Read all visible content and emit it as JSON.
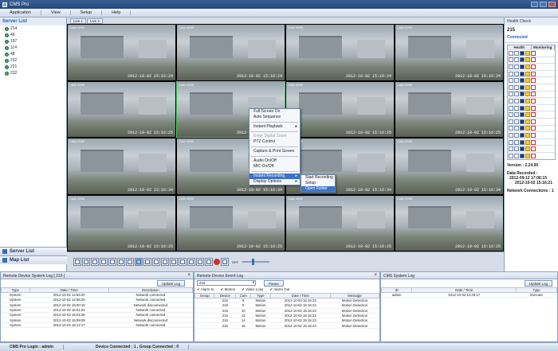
{
  "window": {
    "title": "CMS Pro"
  },
  "menu": [
    "Application",
    "View",
    "Setup",
    "Help"
  ],
  "server_list": {
    "title": "Server List",
    "items": [
      "214",
      "46",
      "197",
      "114",
      "48",
      "232",
      "221",
      "232"
    ]
  },
  "left_buttons": {
    "server": "Server List",
    "map": "Map List"
  },
  "tabs": [
    "Live 1",
    "Live 2"
  ],
  "cameras": [
    {
      "name": "CAM 9999",
      "ts": "2012-10-02 15:16:24"
    },
    {
      "name": "CAM 9999",
      "ts": "2012-10-02 15:16:24"
    },
    {
      "name": "CAM 9999",
      "ts": "2012-10-02 15:16:24"
    },
    {
      "name": "CAM 9999",
      "ts": "2012-10-02 15:16:24"
    },
    {
      "name": "CAM 9999",
      "ts": "2012-10-02 15:16:25"
    },
    {
      "name": "CAM 9999",
      "ts": "2012-10-02 15:16:25"
    },
    {
      "name": "CAM 9999",
      "ts": "2012-10-02 15:16:25"
    },
    {
      "name": "CAM 9999",
      "ts": "2012-10-02 15:16:25"
    },
    {
      "name": "CAM 9999",
      "ts": "2012-10-02 15:16:34"
    },
    {
      "name": "CAM 9999",
      "ts": "2012-10-02 15:16:34"
    },
    {
      "name": "CAM 9999",
      "ts": "2012-10-02 15:16:34"
    },
    {
      "name": "CAM 9999",
      "ts": "2012-10-02 15:16:34"
    },
    {
      "name": "CAM 9999",
      "ts": "2012-10-02 15:16:25"
    },
    {
      "name": "CAM 9999",
      "ts": "2012-10-02 15:16:25"
    },
    {
      "name": "CAM 9999",
      "ts": "2012-10-02 15:16:25"
    },
    {
      "name": "CAM 9999",
      "ts": "2012-10-02 15:16:25"
    }
  ],
  "context_menu": {
    "items": [
      "Full Screen On",
      "Auto Sequence",
      "Instant Playback",
      "Enter Digital Zoom",
      "PTZ Control",
      "Capture & Print Screen",
      "Audio On/Off",
      "MIC On/Off",
      "Instant Recording",
      "Display Options"
    ]
  },
  "submenu": {
    "items": [
      "Start Recording",
      "Setup",
      "Open Folder"
    ]
  },
  "audio_state": "OFF",
  "health": {
    "title": "Health Check",
    "server": "215",
    "connected": "Connected",
    "col1": "Health",
    "col2": "Monitoring",
    "version_label": "Version :",
    "version": "2.24.00",
    "data_label": "Data Recorded :",
    "data_from": "2012-09-12 17:06:15",
    "data_to": "2012-10-02 15:16:21",
    "net_label": "Network Connections :",
    "net": "1"
  },
  "system_log": {
    "title": "Remote Device System Log [ 215 ]",
    "update": "Update Log",
    "headers": [
      "Type",
      "Date / Time",
      "Description"
    ],
    "rows": [
      [
        "System",
        "2012-10-02 14:56:20",
        "Network connected"
      ],
      [
        "System",
        "2012-10-02 14:56:20",
        "Network connected"
      ],
      [
        "System",
        "2012-10-02 15:00:16",
        "Network disconnected"
      ],
      [
        "System",
        "2012-10-02 15:01:01",
        "Network connected"
      ],
      [
        "System",
        "2012-10-02 15:01:06",
        "Network connected"
      ],
      [
        "System",
        "2012-10-02 15:09:09",
        "Network disconnected"
      ],
      [
        "System",
        "2012-10-02 15:12:17",
        "Network connected"
      ]
    ]
  },
  "event_log": {
    "title": "Remote Device Event Log",
    "device": "215",
    "pause": "Pause",
    "filters": [
      "Alarm In",
      "Motion",
      "Video Loss",
      "Alarm Out"
    ],
    "headers": [
      "Group",
      "Device",
      "Cam",
      "Type",
      "Date / Time",
      "Message"
    ],
    "rows": [
      [
        "",
        "215",
        "8",
        "Motion",
        "2012-10-02 15:16:23",
        "Motion Detection"
      ],
      [
        "",
        "215",
        "9",
        "Motion",
        "2012-10-02 15:16:23",
        "Motion Detection"
      ],
      [
        "",
        "215",
        "10",
        "Motion",
        "2012-10-02 15:16:23",
        "Motion Detection"
      ],
      [
        "",
        "215",
        "11",
        "Motion",
        "2012-10-02 15:16:23",
        "Motion Detection"
      ],
      [
        "",
        "215",
        "14",
        "Motion",
        "2012-10-02 15:16:23",
        "Motion Detection"
      ],
      [
        "",
        "215",
        "16",
        "Motion",
        "2012-10-02 15:16:23",
        "Motion Detection"
      ]
    ]
  },
  "cms_log": {
    "title": "CMS System Log",
    "update": "Update Log",
    "headers": [
      "ID",
      "Date / Time",
      "Type"
    ],
    "rows": [
      [
        "admin",
        "2012-10-02 14:49:17",
        "Execute"
      ]
    ]
  },
  "status": {
    "login": "CMS Pro Login : admin",
    "devices": "Device Connected : 1 , Group Connected : 0"
  }
}
